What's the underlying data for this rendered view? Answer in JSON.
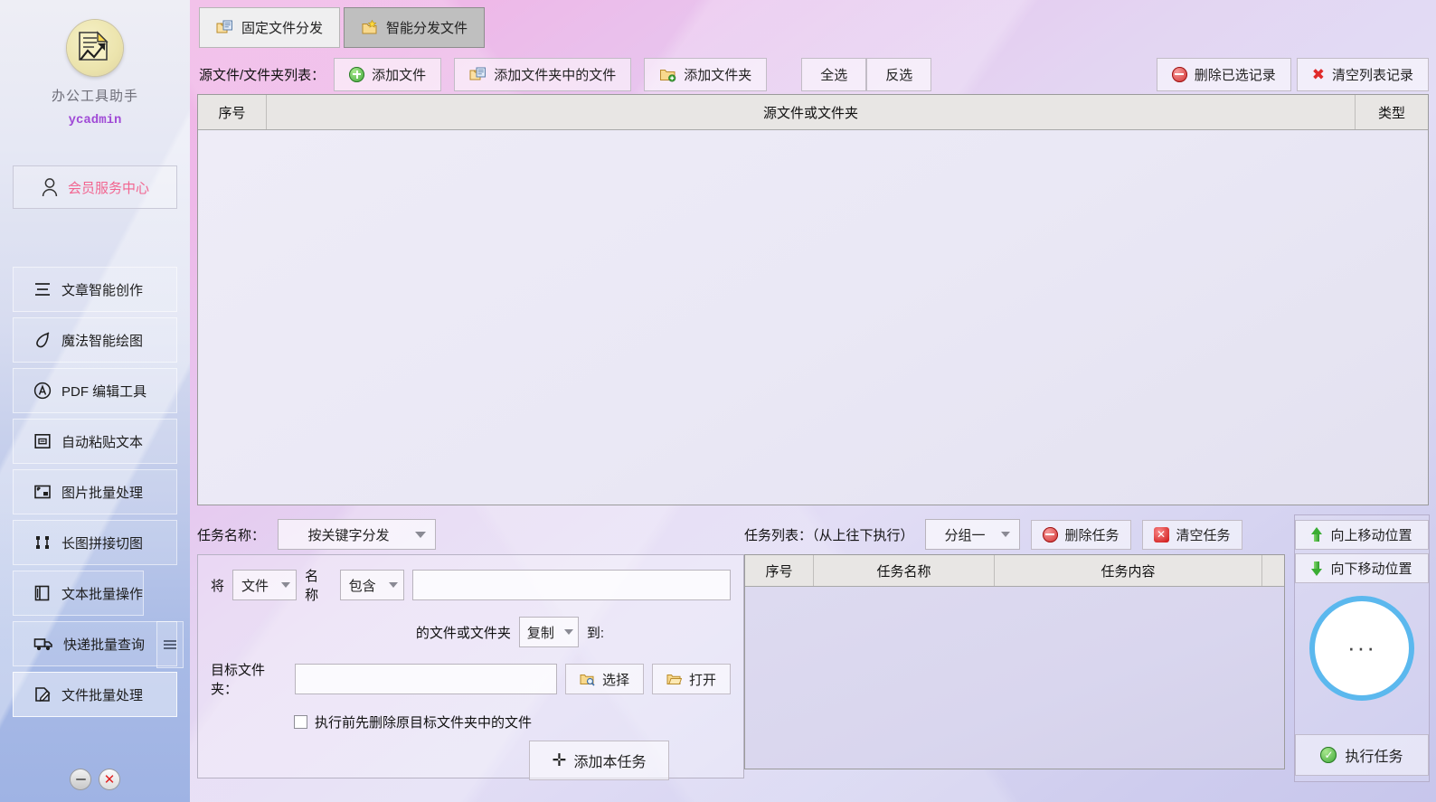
{
  "sidebar": {
    "app_title": "办公工具助手",
    "user_name": "ycadmin",
    "vip_label": "会员服务中心",
    "nav_items": [
      {
        "label": "文章智能创作",
        "icon": "lines-icon"
      },
      {
        "label": "魔法智能绘图",
        "icon": "brush-icon"
      },
      {
        "label": "PDF 编辑工具",
        "icon": "pdf-icon"
      },
      {
        "label": "自动粘贴文本",
        "icon": "paste-icon"
      },
      {
        "label": "图片批量处理",
        "icon": "image-icon"
      },
      {
        "label": "长图拼接切图",
        "icon": "crop-icon"
      },
      {
        "label": "文本批量操作",
        "icon": "book-icon"
      },
      {
        "label": "快递批量查询",
        "icon": "truck-icon"
      },
      {
        "label": "文件批量处理",
        "icon": "file-edit-icon"
      }
    ],
    "minimize_label": "最小化",
    "close_label": "关闭"
  },
  "tabs": [
    {
      "label": "固定文件分发",
      "active": false
    },
    {
      "label": "智能分发文件",
      "active": true
    }
  ],
  "toolbar": {
    "source_label": "源文件/文件夹列表：",
    "add_file": "添加文件",
    "add_files_in_folder": "添加文件夹中的文件",
    "add_folder": "添加文件夹",
    "select_all": "全选",
    "invert_select": "反选",
    "delete_selected": "删除已选记录",
    "clear_list": "清空列表记录"
  },
  "file_table": {
    "headers": [
      "序号",
      "源文件或文件夹",
      "类型"
    ],
    "rows": []
  },
  "task_form": {
    "task_name_label": "任务名称：",
    "task_name_value": "按关键字分发",
    "prefix_label": "将",
    "target_type_value": "文件",
    "name_label": "名称",
    "match_value": "包含",
    "keyword_value": "",
    "of_label": "的文件或文件夹",
    "action_value": "复制",
    "to_label": "到:",
    "dest_label": "目标文件夹：",
    "dest_value": "",
    "choose_button": "选择",
    "open_button": "打开",
    "delete_before_label": "执行前先删除原目标文件夹中的文件",
    "delete_before_checked": false,
    "add_task_button": "添加本任务"
  },
  "task_list": {
    "title": "任务列表：（从上往下执行）",
    "group_value": "分组一",
    "delete_task": "删除任务",
    "clear_task": "清空任务",
    "headers": [
      "序号",
      "任务名称",
      "任务内容"
    ],
    "rows": []
  },
  "right_rail": {
    "move_up": "向上移动位置",
    "move_down": "向下移动位置",
    "circle_label": "···",
    "run_button": "执行任务"
  },
  "colors": {
    "accent_pink": "#f2648f",
    "user_purple": "#a04ad6",
    "ring_blue": "#5bb8ee",
    "green": "#3aa534",
    "red": "#d02a2a"
  }
}
